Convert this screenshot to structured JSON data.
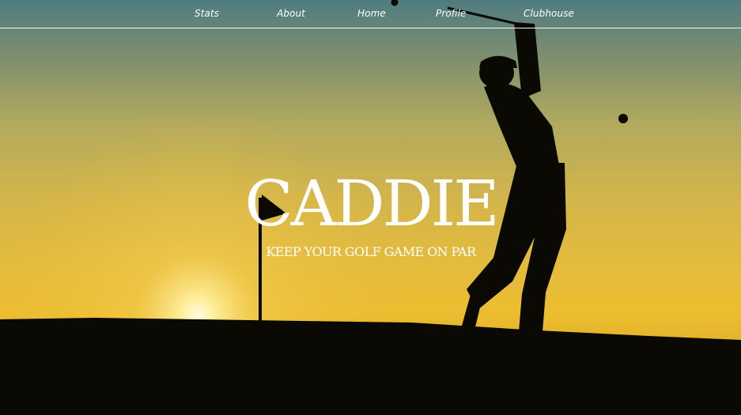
{
  "nav": {
    "items": [
      {
        "label": "Stats"
      },
      {
        "label": "About"
      },
      {
        "label": "Home"
      },
      {
        "label": "Profile"
      },
      {
        "label": "Clubhouse"
      }
    ]
  },
  "hero": {
    "title": "CADDIE",
    "tagline": "KEEP YOUR GOLF GAME ON PAR",
    "image": "golfer silhouette at sunset with flag pin",
    "colors": {
      "sky_top": "#4f7c80",
      "sky_mid": "#d3b54b",
      "sun_glow": "#fff7c8",
      "silhouette": "#0a0804",
      "text": "#ffffff"
    }
  }
}
